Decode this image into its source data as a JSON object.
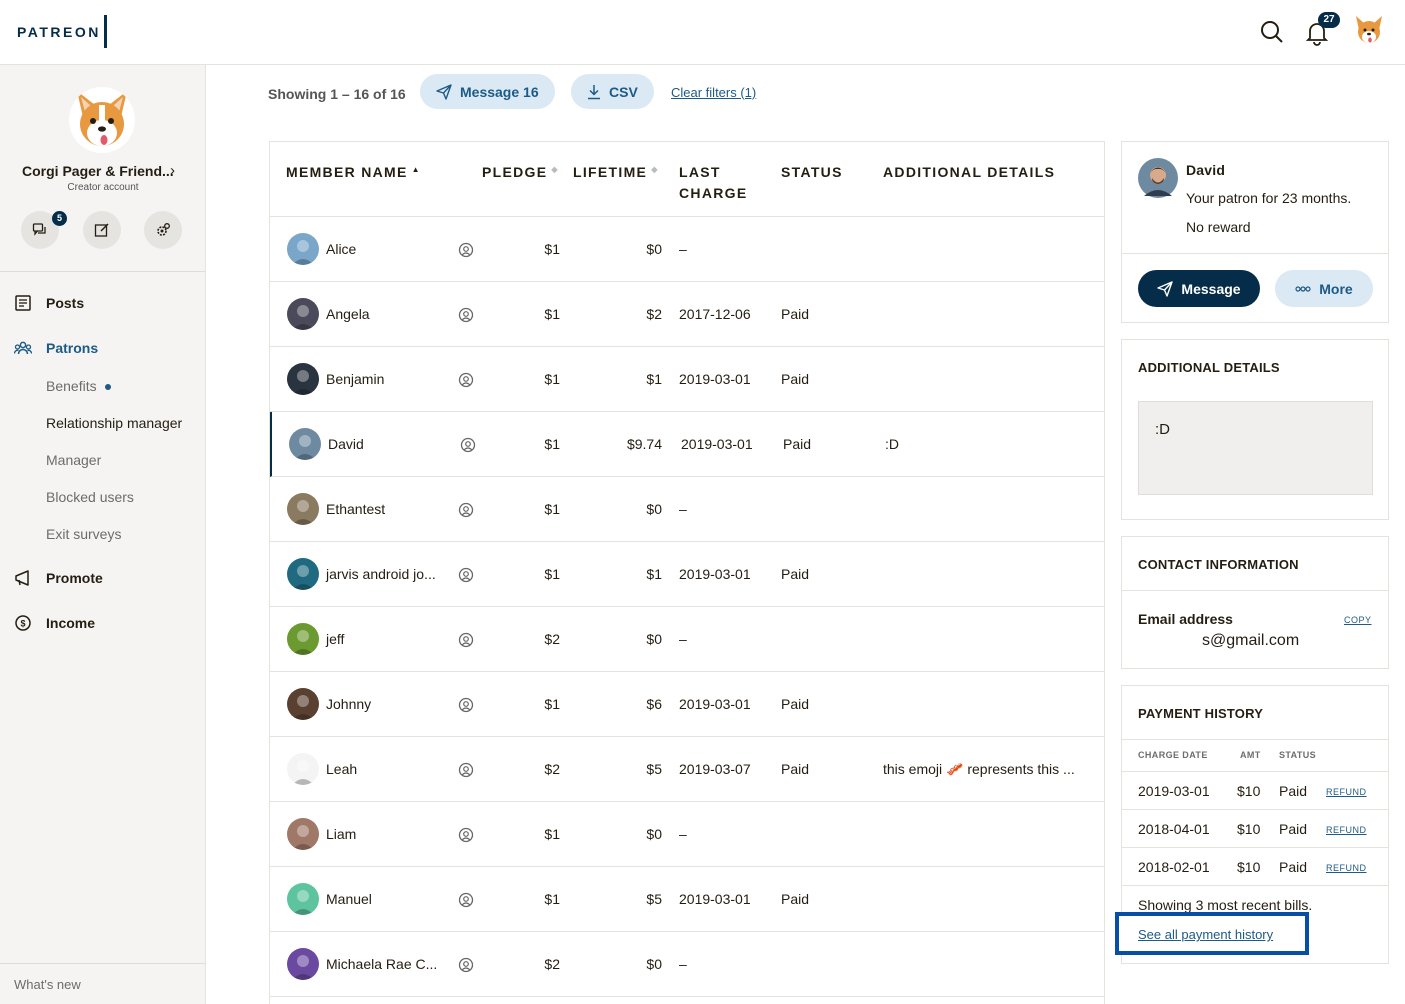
{
  "header": {
    "logo": "PATREON",
    "notification_count": "27"
  },
  "sidebar": {
    "creator_name": "Corgi Pager & Friend...",
    "creator_sub": "Creator account",
    "messages_badge": "5",
    "nav": {
      "posts": "Posts",
      "patrons": "Patrons",
      "benefits": "Benefits",
      "relationship_manager": "Relationship manager",
      "manager": "Manager",
      "blocked_users": "Blocked users",
      "exit_surveys": "Exit surveys",
      "promote": "Promote",
      "income": "Income"
    },
    "whats_new": "What's new"
  },
  "toolbar": {
    "showing": "Showing 1 – 16 of 16",
    "message_btn": "Message 16",
    "csv_btn": "CSV",
    "clear_filters": "Clear filters (1)"
  },
  "table": {
    "headers": {
      "member_name": "MEMBER NAME",
      "pledge": "PLEDGE",
      "lifetime": "LIFETIME",
      "last_charge_1": "LAST",
      "last_charge_2": "CHARGE",
      "status": "STATUS",
      "additional_details": "ADDITIONAL DETAILS"
    },
    "rows": [
      {
        "name": "Alice",
        "pledge": "$1",
        "lifetime": "$0",
        "last_charge": "–",
        "status": "",
        "details": ""
      },
      {
        "name": "Angela",
        "pledge": "$1",
        "lifetime": "$2",
        "last_charge": "2017-12-06",
        "status": "Paid",
        "details": ""
      },
      {
        "name": "Benjamin",
        "pledge": "$1",
        "lifetime": "$1",
        "last_charge": "2019-03-01",
        "status": "Paid",
        "details": ""
      },
      {
        "name": "David",
        "pledge": "$1",
        "lifetime": "$9.74",
        "last_charge": "2019-03-01",
        "status": "Paid",
        "details": ":D"
      },
      {
        "name": "Ethantest",
        "pledge": "$1",
        "lifetime": "$0",
        "last_charge": "–",
        "status": "",
        "details": ""
      },
      {
        "name": "jarvis android jo...",
        "pledge": "$1",
        "lifetime": "$1",
        "last_charge": "2019-03-01",
        "status": "Paid",
        "details": ""
      },
      {
        "name": "jeff",
        "pledge": "$2",
        "lifetime": "$0",
        "last_charge": "–",
        "status": "",
        "details": ""
      },
      {
        "name": "Johnny",
        "pledge": "$1",
        "lifetime": "$6",
        "last_charge": "2019-03-01",
        "status": "Paid",
        "details": ""
      },
      {
        "name": "Leah",
        "pledge": "$2",
        "lifetime": "$5",
        "last_charge": "2019-03-07",
        "status": "Paid",
        "details": "this emoji 🥓 represents this ..."
      },
      {
        "name": "Liam",
        "pledge": "$1",
        "lifetime": "$0",
        "last_charge": "–",
        "status": "",
        "details": ""
      },
      {
        "name": "Manuel",
        "pledge": "$1",
        "lifetime": "$5",
        "last_charge": "2019-03-01",
        "status": "Paid",
        "details": ""
      },
      {
        "name": "Michaela Rae C...",
        "pledge": "$2",
        "lifetime": "$0",
        "last_charge": "–",
        "status": "",
        "details": ""
      }
    ]
  },
  "patron_card": {
    "name": "David",
    "tenure": "Your patron for 23 months.",
    "reward": "No reward",
    "message_btn": "Message",
    "more_btn": "More"
  },
  "additional_details": {
    "title": "ADDITIONAL DETAILS",
    "value": ":D"
  },
  "contact": {
    "title": "CONTACT INFORMATION",
    "email_label": "Email address",
    "copy": "COPY",
    "email": "s@gmail.com"
  },
  "payment_history": {
    "title": "PAYMENT HISTORY",
    "col_date": "CHARGE DATE",
    "col_amt": "AMT",
    "col_status": "STATUS",
    "rows": [
      {
        "date": "2019-03-01",
        "amt": "$10",
        "status": "Paid",
        "action": "REFUND"
      },
      {
        "date": "2018-04-01",
        "amt": "$10",
        "status": "Paid",
        "action": "REFUND"
      },
      {
        "date": "2018-02-01",
        "amt": "$10",
        "status": "Paid",
        "action": "REFUND"
      }
    ],
    "showing": "Showing 3 most recent bills.",
    "see_all": "See all payment history"
  },
  "colors": {
    "brand_navy": "#052d49",
    "link_blue": "#1d5a86",
    "pill_bg": "#dbe9f5",
    "focus_outline": "#064ea6"
  }
}
